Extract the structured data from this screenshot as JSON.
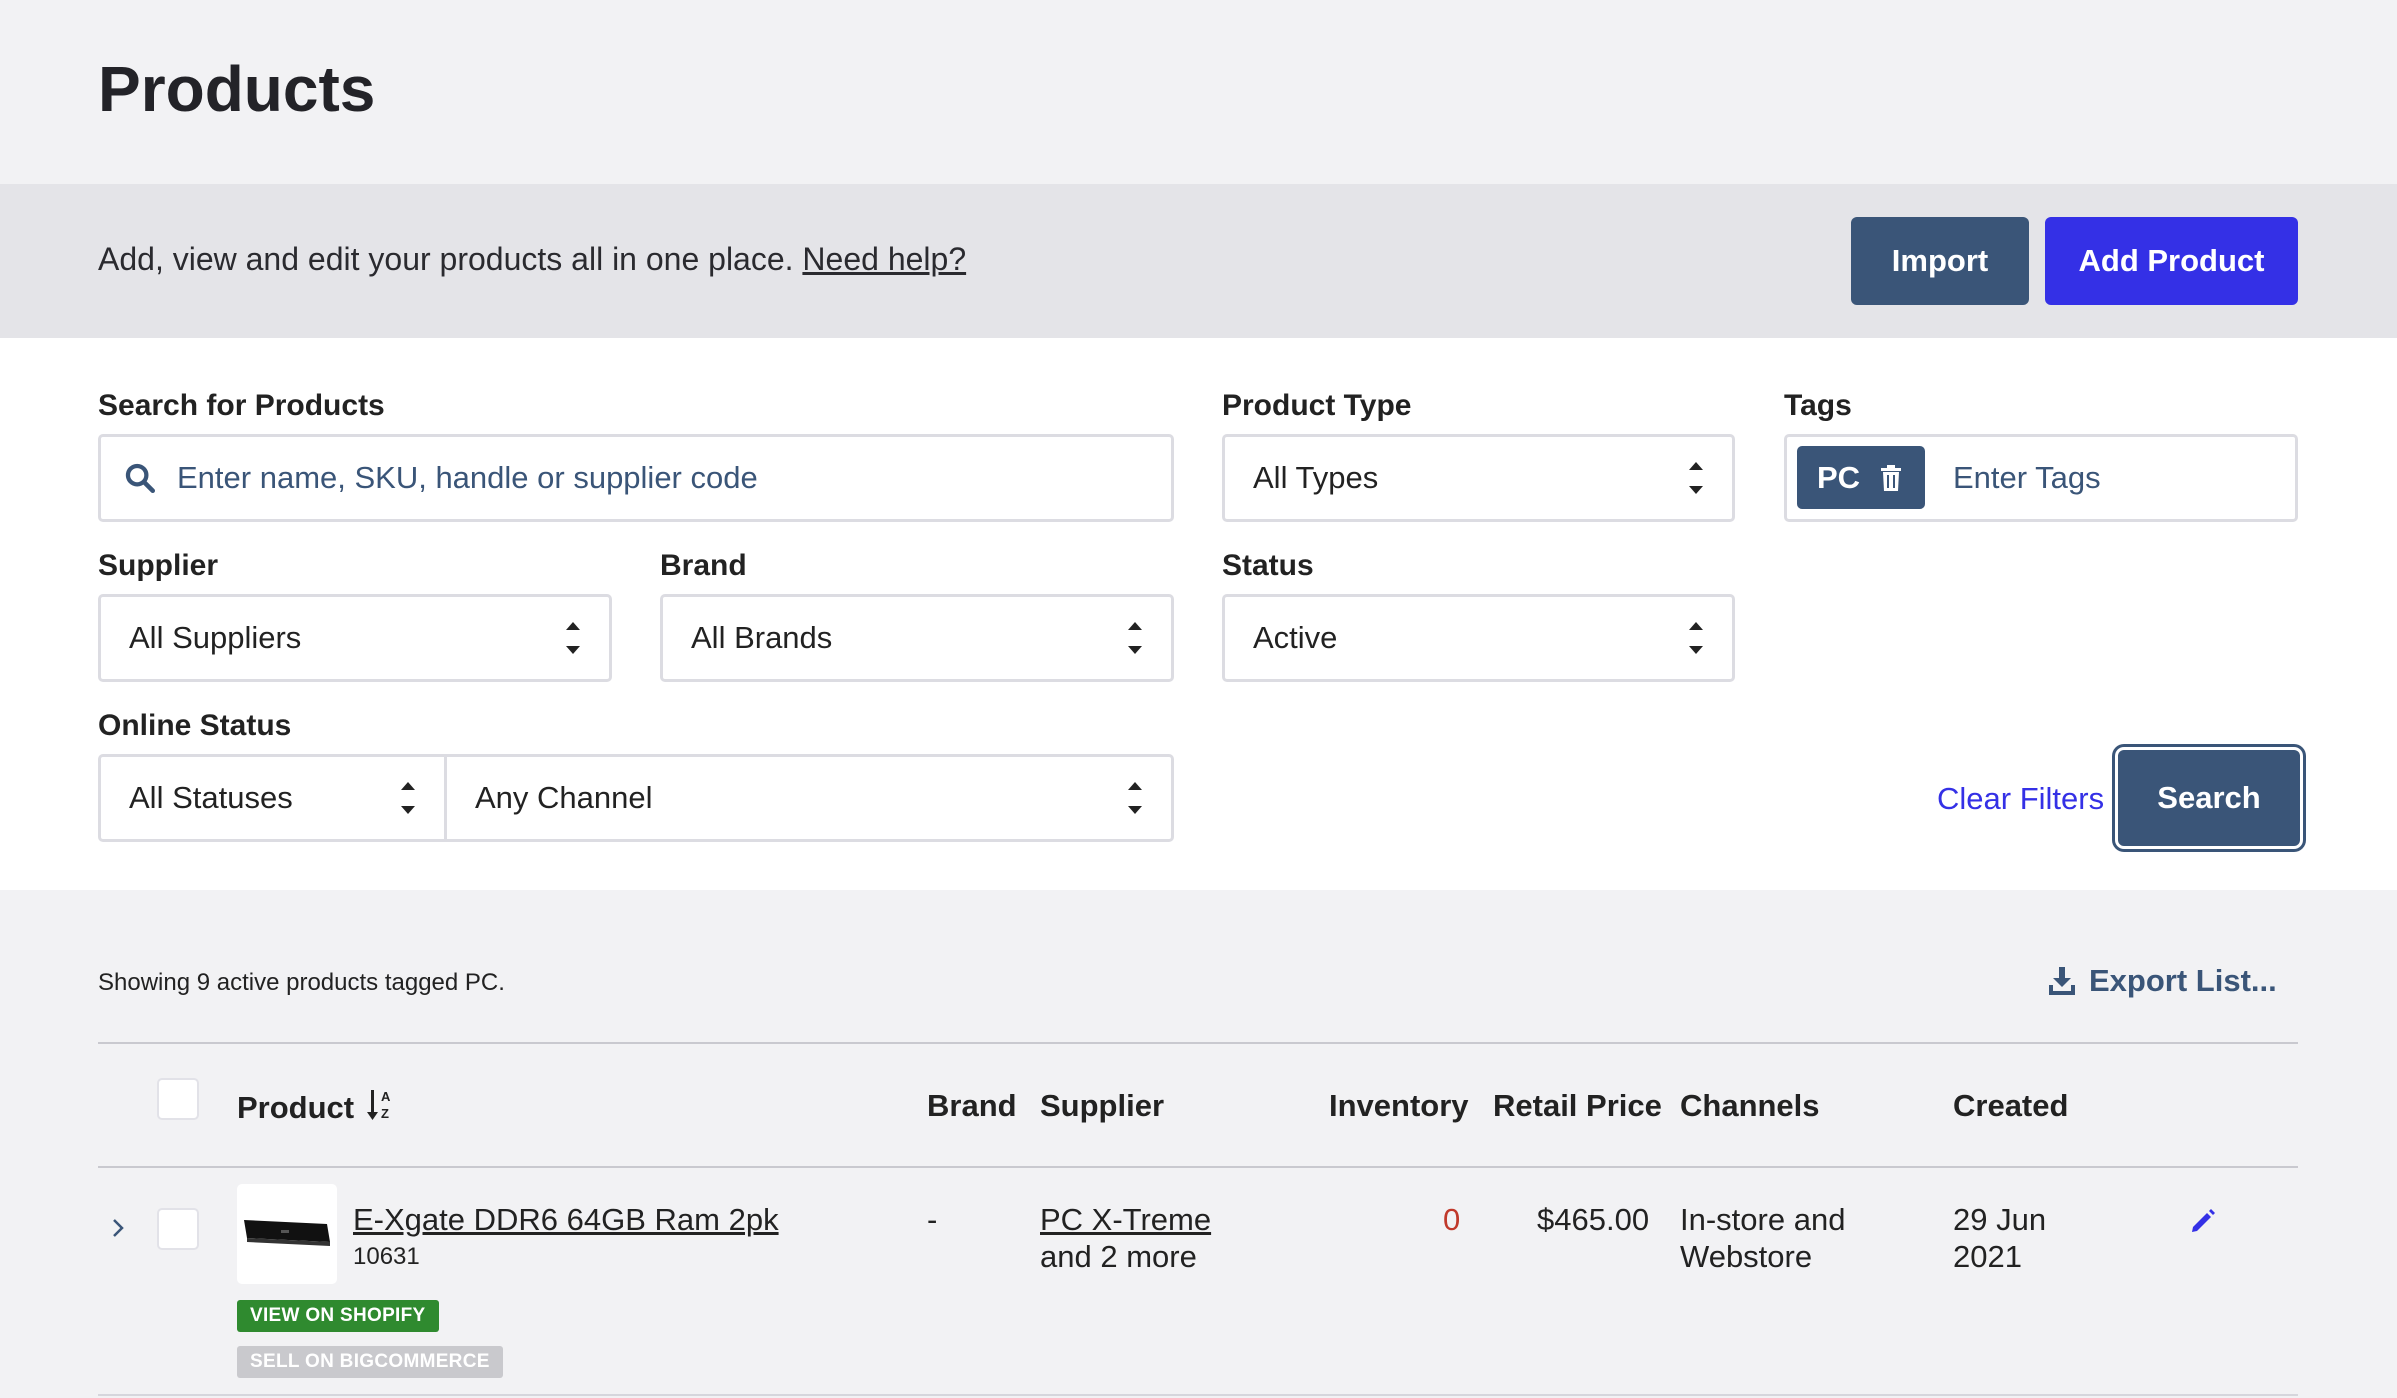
{
  "page": {
    "title": "Products"
  },
  "banner": {
    "text": "Add, view and edit your products all in one place.",
    "help_link": "Need help?",
    "import_label": "Import",
    "add_label": "Add Product"
  },
  "filters": {
    "search_label": "Search for Products",
    "search_placeholder": "Enter name, SKU, handle or supplier code",
    "product_type_label": "Product Type",
    "product_type_value": "All Types",
    "tags_label": "Tags",
    "tag_chip": "PC",
    "tags_placeholder": "Enter Tags",
    "supplier_label": "Supplier",
    "supplier_value": "All Suppliers",
    "brand_label": "Brand",
    "brand_value": "All Brands",
    "status_label": "Status",
    "status_value": "Active",
    "online_status_label": "Online Status",
    "online_status_value": "All Statuses",
    "channel_value": "Any Channel",
    "clear_label": "Clear Filters",
    "search_button": "Search"
  },
  "results": {
    "summary": "Showing 9 active products tagged PC.",
    "export_label": "Export List..."
  },
  "table": {
    "headers": {
      "product": "Product",
      "brand": "Brand",
      "supplier": "Supplier",
      "inventory": "Inventory",
      "retail_price": "Retail Price",
      "channels": "Channels",
      "created": "Created"
    },
    "rows": [
      {
        "name": "E-Xgate DDR6 64GB Ram 2pk",
        "sku": "10631",
        "brand": "-",
        "supplier": "PC X-Treme",
        "supplier_more": "and 2 more",
        "inventory": "0",
        "retail_price": "$465.00",
        "channels_line1": "In-store and",
        "channels_line2": "Webstore",
        "created_line1": "29 Jun",
        "created_line2": "2021",
        "badge_shopify": "VIEW ON SHOPIFY",
        "badge_bigcommerce": "SELL ON BIGCOMMERCE"
      }
    ]
  },
  "colors": {
    "primary": "#3a5578",
    "accent": "#3430e6",
    "inventory_zero": "#c0392b",
    "shopify_badge": "#2f8a2f",
    "bigcommerce_badge": "#c9c9cd"
  }
}
